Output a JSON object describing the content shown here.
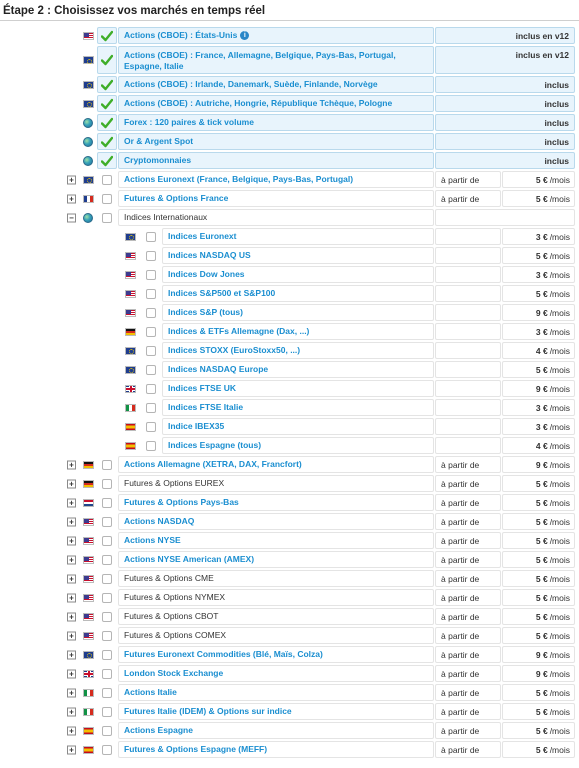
{
  "page": {
    "title": "Étape 2 : Choisissez vos marchés en temps réel"
  },
  "colors": {
    "link": "#1a8ed0",
    "included_bg": "#e8f4fc",
    "check_green": "#3fae29"
  },
  "included": [
    {
      "flag": "us-flag-icon",
      "name": "Actions (CBOE) : États-Unis",
      "info": true,
      "status": "inclus en v12"
    },
    {
      "flag": "eu-flag-icon",
      "name": "Actions (CBOE) : France, Allemagne, Belgique, Pays-Bas, Portugal, Espagne, Italie",
      "status": "inclus en v12"
    },
    {
      "flag": "eu-flag-icon",
      "name": "Actions (CBOE) : Irlande, Danemark, Suède, Finlande, Norvège",
      "status": "inclus"
    },
    {
      "flag": "eu-flag-icon",
      "name": "Actions (CBOE) : Autriche, Hongrie, République Tchèque, Pologne",
      "status": "inclus"
    },
    {
      "flag": "globe-icon",
      "name": "Forex : 120 paires & tick volume",
      "status": "inclus"
    },
    {
      "flag": "globe-icon",
      "name": "Or & Argent Spot",
      "status": "inclus"
    },
    {
      "flag": "globe-icon",
      "name": "Cryptomonnaies",
      "status": "inclus"
    }
  ],
  "markets_top": [
    {
      "flag": "eu-flag-icon",
      "name": "Actions Euronext (France, Belgique, Pays-Bas, Portugal)",
      "link": true,
      "from": "à partir de",
      "price": "5 €",
      "unit": "/mois"
    },
    {
      "flag": "fr-flag-icon",
      "name": "Futures & Options France",
      "link": true,
      "from": "à partir de",
      "price": "5 €",
      "unit": "/mois"
    }
  ],
  "indices_group": {
    "name": "Indices Internationaux",
    "items": [
      {
        "flag": "eu-flag-icon",
        "name": "Indices Euronext",
        "price": "3 €",
        "unit": "/mois"
      },
      {
        "flag": "us-flag-icon",
        "name": "Indices NASDAQ US",
        "price": "5 €",
        "unit": "/mois"
      },
      {
        "flag": "us-flag-icon",
        "name": "Indices Dow Jones",
        "price": "3 €",
        "unit": "/mois"
      },
      {
        "flag": "us-flag-icon",
        "name": "Indices S&P500 et S&P100",
        "price": "5 €",
        "unit": "/mois"
      },
      {
        "flag": "us-flag-icon",
        "name": "Indices S&P (tous)",
        "price": "9 €",
        "unit": "/mois"
      },
      {
        "flag": "de-flag-icon",
        "name": "Indices & ETFs Allemagne (Dax, ...)",
        "price": "3 €",
        "unit": "/mois"
      },
      {
        "flag": "eu-flag-icon",
        "name": "Indices STOXX (EuroStoxx50, ...)",
        "price": "4 €",
        "unit": "/mois"
      },
      {
        "flag": "eu-flag-icon",
        "name": "Indices NASDAQ Europe",
        "price": "5 €",
        "unit": "/mois"
      },
      {
        "flag": "uk-flag-icon",
        "name": "Indices FTSE UK",
        "price": "9 €",
        "unit": "/mois"
      },
      {
        "flag": "it-flag-icon",
        "name": "Indices FTSE Italie",
        "price": "3 €",
        "unit": "/mois"
      },
      {
        "flag": "es-flag-icon",
        "name": "Indice IBEX35",
        "price": "3 €",
        "unit": "/mois"
      },
      {
        "flag": "es-flag-icon",
        "name": "Indices Espagne (tous)",
        "price": "4 €",
        "unit": "/mois"
      }
    ]
  },
  "markets_bottom": [
    {
      "flag": "de-flag-icon",
      "name": "Actions Allemagne (XETRA, DAX, Francfort)",
      "link": true,
      "from": "à partir de",
      "price": "9 €",
      "unit": "/mois"
    },
    {
      "flag": "de-flag-icon",
      "name": "Futures & Options EUREX",
      "link": false,
      "from": "à partir de",
      "price": "5 €",
      "unit": "/mois"
    },
    {
      "flag": "nl-flag-icon",
      "name": "Futures & Options Pays-Bas",
      "link": true,
      "from": "à partir de",
      "price": "5 €",
      "unit": "/mois"
    },
    {
      "flag": "us-flag-icon",
      "name": "Actions NASDAQ",
      "link": true,
      "from": "à partir de",
      "price": "5 €",
      "unit": "/mois"
    },
    {
      "flag": "us-flag-icon",
      "name": "Actions NYSE",
      "link": true,
      "from": "à partir de",
      "price": "5 €",
      "unit": "/mois"
    },
    {
      "flag": "us-flag-icon",
      "name": "Actions NYSE American (AMEX)",
      "link": true,
      "from": "à partir de",
      "price": "5 €",
      "unit": "/mois"
    },
    {
      "flag": "us-flag-icon",
      "name": "Futures & Options CME",
      "link": false,
      "from": "à partir de",
      "price": "5 €",
      "unit": "/mois"
    },
    {
      "flag": "us-flag-icon",
      "name": "Futures & Options NYMEX",
      "link": false,
      "from": "à partir de",
      "price": "5 €",
      "unit": "/mois"
    },
    {
      "flag": "us-flag-icon",
      "name": "Futures & Options CBOT",
      "link": false,
      "from": "à partir de",
      "price": "5 €",
      "unit": "/mois"
    },
    {
      "flag": "us-flag-icon",
      "name": "Futures & Options COMEX",
      "link": false,
      "from": "à partir de",
      "price": "5 €",
      "unit": "/mois"
    },
    {
      "flag": "eu-flag-icon",
      "name": "Futures Euronext Commodities (Blé, Maïs, Colza)",
      "link": true,
      "from": "à partir de",
      "price": "9 €",
      "unit": "/mois"
    },
    {
      "flag": "uk-flag-icon",
      "name": "London Stock Exchange",
      "link": true,
      "from": "à partir de",
      "price": "9 €",
      "unit": "/mois"
    },
    {
      "flag": "it-flag-icon",
      "name": "Actions Italie",
      "link": true,
      "from": "à partir de",
      "price": "5 €",
      "unit": "/mois"
    },
    {
      "flag": "it-flag-icon",
      "name": "Futures Italie (IDEM) & Options sur indice",
      "link": true,
      "from": "à partir de",
      "price": "5 €",
      "unit": "/mois"
    },
    {
      "flag": "es-flag-icon",
      "name": "Actions Espagne",
      "link": true,
      "from": "à partir de",
      "price": "5 €",
      "unit": "/mois"
    },
    {
      "flag": "es-flag-icon",
      "name": "Futures & Options Espagne (MEFF)",
      "link": true,
      "from": "à partir de",
      "price": "5 €",
      "unit": "/mois"
    }
  ]
}
